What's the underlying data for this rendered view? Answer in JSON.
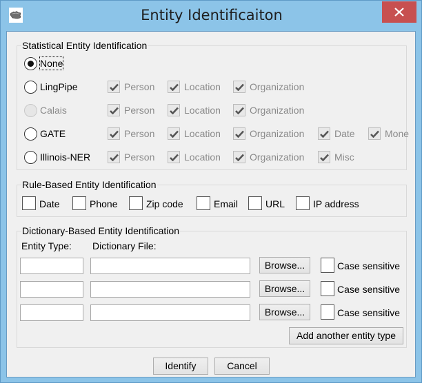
{
  "window": {
    "title": "Entity Identificaiton",
    "icon": "puzzle-piece-icon",
    "close_icon": "close-icon"
  },
  "statistical": {
    "title": "Statistical Entity Identification",
    "options": [
      {
        "label": "None",
        "selected": true,
        "enabled": true,
        "entities": []
      },
      {
        "label": "LingPipe",
        "selected": false,
        "enabled": true,
        "entities": [
          {
            "label": "Person",
            "checked": true
          },
          {
            "label": "Location",
            "checked": true
          },
          {
            "label": "Organization",
            "checked": true
          }
        ]
      },
      {
        "label": "Calais",
        "selected": false,
        "enabled": false,
        "entities": [
          {
            "label": "Person",
            "checked": true
          },
          {
            "label": "Location",
            "checked": true
          },
          {
            "label": "Organization",
            "checked": true
          }
        ]
      },
      {
        "label": "GATE",
        "selected": false,
        "enabled": true,
        "entities": [
          {
            "label": "Person",
            "checked": true
          },
          {
            "label": "Location",
            "checked": true
          },
          {
            "label": "Organization",
            "checked": true
          },
          {
            "label": "Date",
            "checked": true
          },
          {
            "label": "Mone",
            "checked": true
          }
        ]
      },
      {
        "label": "Illinois-NER",
        "selected": false,
        "enabled": true,
        "entities": [
          {
            "label": "Person",
            "checked": true
          },
          {
            "label": "Location",
            "checked": true
          },
          {
            "label": "Organization",
            "checked": true
          },
          {
            "label": "Misc",
            "checked": true
          }
        ]
      }
    ]
  },
  "rule_based": {
    "title": "Rule-Based Entity Identification",
    "options": [
      {
        "label": "Date",
        "checked": false
      },
      {
        "label": "Phone",
        "checked": false
      },
      {
        "label": "Zip code",
        "checked": false
      },
      {
        "label": "Email",
        "checked": false
      },
      {
        "label": "URL",
        "checked": false
      },
      {
        "label": "IP address",
        "checked": false
      }
    ]
  },
  "dictionary": {
    "title": "Dictionary-Based Entity Identification",
    "entity_type_label": "Entity Type:",
    "dictionary_file_label": "Dictionary File:",
    "rows": [
      {
        "entity_type": "",
        "dictionary_file": "",
        "browse_label": "Browse...",
        "case_sensitive_label": "Case sensitive",
        "case_sensitive": false
      },
      {
        "entity_type": "",
        "dictionary_file": "",
        "browse_label": "Browse...",
        "case_sensitive_label": "Case sensitive",
        "case_sensitive": false
      },
      {
        "entity_type": "",
        "dictionary_file": "",
        "browse_label": "Browse...",
        "case_sensitive_label": "Case sensitive",
        "case_sensitive": false
      }
    ],
    "add_label": "Add another entity type"
  },
  "footer": {
    "identify_label": "Identify",
    "cancel_label": "Cancel"
  }
}
